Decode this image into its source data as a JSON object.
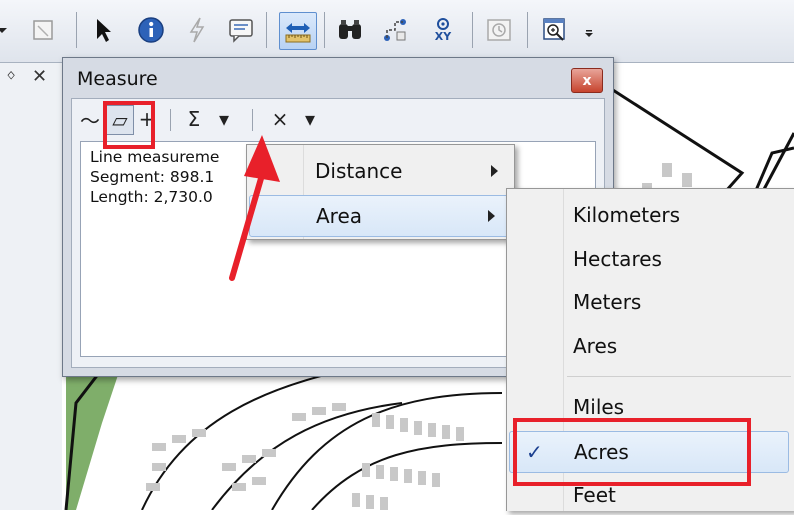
{
  "toolbar": {
    "icons": [
      "dropdown-arrow-icon",
      "select-elements-icon",
      "select-pointer-icon",
      "identify-icon",
      "hyperlink-icon",
      "html-popup-icon",
      "measure-icon",
      "find-icon",
      "find-route-icon",
      "go-to-xy-icon",
      "time-slider-icon",
      "create-viewer-window-icon"
    ],
    "go_to_xy_label": "XY"
  },
  "left_panel": {
    "pin": "ᛜ",
    "close": "✕"
  },
  "measure_window": {
    "title": "Measure",
    "close_glyph": "x",
    "tools": {
      "measure_line": "〜",
      "measure_area": "▱",
      "measure_feature": "+",
      "sum": "Σ",
      "choose_units": "▾",
      "clear": "×",
      "clear_dropdown": "▾"
    },
    "results": {
      "line1": "Line measureme",
      "line2": "Segment: 898.1",
      "line3": "Length: 2,730.0"
    }
  },
  "units_menu": {
    "items": [
      {
        "label": "Distance",
        "has_submenu": true
      },
      {
        "label": "Area",
        "has_submenu": true,
        "highlighted": true
      }
    ]
  },
  "area_submenu": {
    "group1": [
      "Kilometers",
      "Hectares",
      "Meters",
      "Ares"
    ],
    "group2": [
      "Miles",
      "Acres",
      "Feet"
    ],
    "checked": "Acres",
    "check_glyph": "✓"
  },
  "colors": {
    "annotation_red": "#e8202a",
    "map_green": "#7fae6a",
    "map_gray": "#c8c8c8",
    "highlight_blue": "#d8e7f8"
  }
}
